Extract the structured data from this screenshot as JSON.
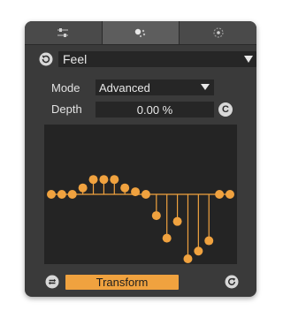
{
  "tabs": [
    {
      "icon": "sliders-icon",
      "active": false
    },
    {
      "icon": "dots-cluster-icon",
      "active": true
    },
    {
      "icon": "target-icon",
      "active": false
    }
  ],
  "preset": {
    "label": "Feel",
    "left_icon": "cycle-icon",
    "arrow_icon": "dropdown-arrow-icon"
  },
  "mode": {
    "label": "Mode",
    "value": "Advanced"
  },
  "depth": {
    "label": "Depth",
    "value": "0.00 %",
    "clear_label": "C"
  },
  "graph": {
    "accent_color": "#f0a23f",
    "background": "#242424",
    "values": [
      0,
      0,
      0,
      0.1,
      0.23,
      0.23,
      0.23,
      0.1,
      0.04,
      0,
      -0.33,
      -0.68,
      -0.42,
      -1.0,
      -0.88,
      -0.72,
      0,
      0
    ]
  },
  "bottom": {
    "transform_label": "Transform",
    "left_icon": "loop-icon",
    "right_icon": "refresh-icon"
  },
  "colors": {
    "panel": "#3a3a3a",
    "field": "#262626",
    "accent": "#f0a23f"
  }
}
